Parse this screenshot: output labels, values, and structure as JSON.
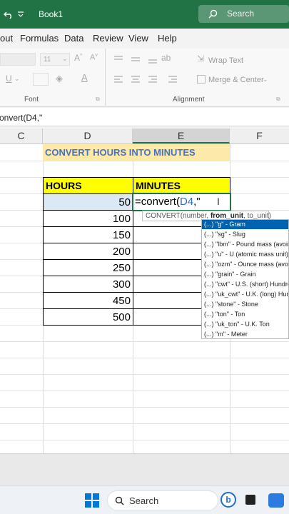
{
  "titlebar": {
    "workbook_name": "Book1",
    "search_placeholder": "Search"
  },
  "menu": {
    "items": [
      "out",
      "Formulas",
      "Data",
      "Review",
      "View",
      "Help"
    ]
  },
  "ribbon": {
    "font_size": "11",
    "wrap_text": "Wrap Text",
    "merge_center": "Merge & Center",
    "font_group": "Font",
    "alignment_group": "Alignment"
  },
  "formula_bar": {
    "content": "onvert(D4,\""
  },
  "columns": [
    "C",
    "D",
    "E",
    "F"
  ],
  "sheet": {
    "title": "CONVERT HOURS INTO MINUTES",
    "header_hours": "HOURS",
    "header_minutes": "MINUTES",
    "hours": [
      "50",
      "100",
      "150",
      "200",
      "250",
      "300",
      "450",
      "500"
    ],
    "editing_prefix": "=convert(",
    "editing_ref": "D4",
    "editing_suffix": ",\""
  },
  "tooltip": {
    "prefix": "CONVERT(number, ",
    "bold": "from_unit",
    "suffix": ", to_unit)"
  },
  "autocomplete": {
    "items": [
      "\"g\" - Gram",
      "\"sg\" - Slug",
      "\"lbm\" - Pound mass (avoird",
      "\"u\" - U (atomic mass unit)",
      "\"ozm\" - Ounce mass (avoird",
      "\"grain\" - Grain",
      "\"cwt\" - U.S. (short) Hundred",
      "\"uk_cwt\" - U.K. (long) Hundr",
      "\"stone\" - Stone",
      "\"ton\" - Ton",
      "\"uk_ton\" - U.K. Ton",
      "\"m\" - Meter"
    ],
    "item_icon": "(...)"
  },
  "taskbar": {
    "search_label": "Search"
  },
  "colors": {
    "excel_green": "#217346",
    "title_fill": "#fde9a9",
    "title_text": "#4472c4",
    "header_fill": "#ffff00",
    "selection_blue": "#0063b1"
  }
}
